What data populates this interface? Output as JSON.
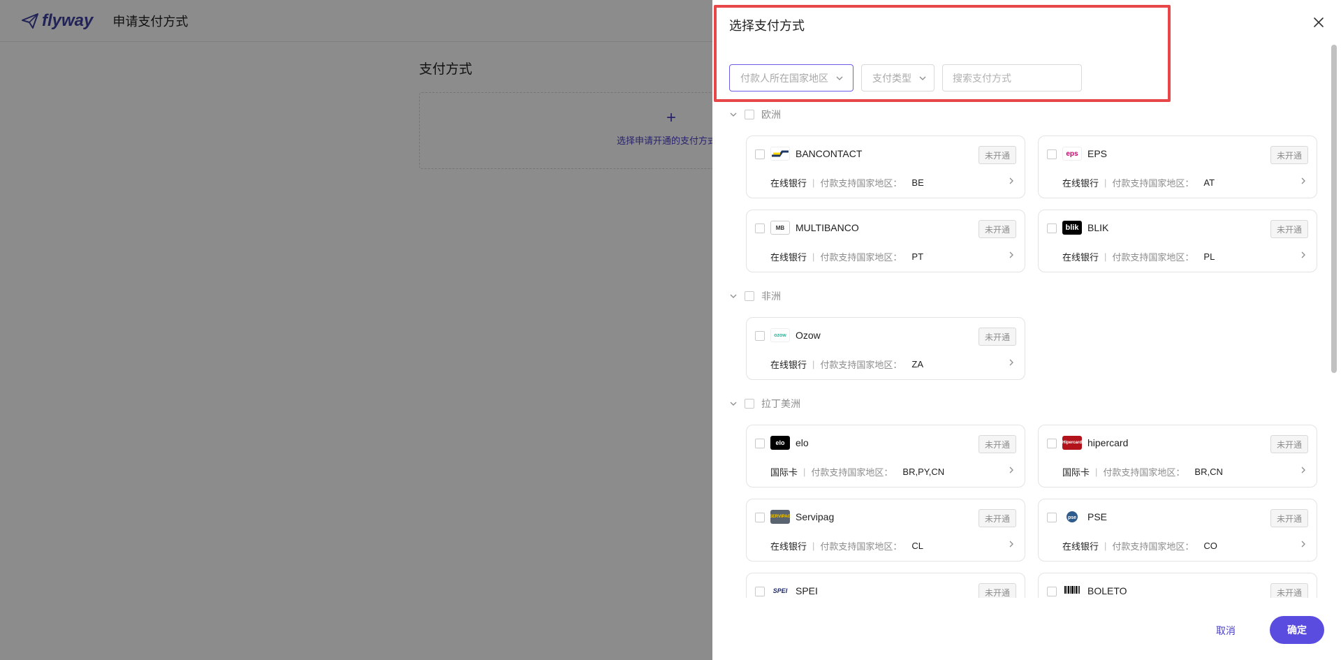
{
  "app": {
    "logo_text": "flyway",
    "page_title": "申请支付方式"
  },
  "background": {
    "section_title": "支付方式",
    "add_icon": "plus-icon",
    "add_text": "选择申请开通的支付方式"
  },
  "drawer": {
    "title": "选择支付方式",
    "close_icon": "close-icon",
    "highlight_color": "#e8474a",
    "filters": {
      "country_placeholder": "付款人所在国家地区",
      "type_placeholder": "支付类型",
      "search_placeholder": "搜索支付方式"
    },
    "regions": [
      {
        "name": "欧洲",
        "methods": [
          {
            "name": "BANCONTACT",
            "status": "未开通",
            "type": "在线银行",
            "label": "付款支持国家地区：",
            "codes": "BE",
            "logo": "bancontact-logo"
          },
          {
            "name": "EPS",
            "status": "未开通",
            "type": "在线银行",
            "label": "付款支持国家地区：",
            "codes": "AT",
            "logo": "eps-logo"
          },
          {
            "name": "MULTIBANCO",
            "status": "未开通",
            "type": "在线银行",
            "label": "付款支持国家地区：",
            "codes": "PT",
            "logo": "multibanco-logo"
          },
          {
            "name": "BLIK",
            "status": "未开通",
            "type": "在线银行",
            "label": "付款支持国家地区：",
            "codes": "PL",
            "logo": "blik-logo"
          }
        ]
      },
      {
        "name": "非洲",
        "methods": [
          {
            "name": "Ozow",
            "status": "未开通",
            "type": "在线银行",
            "label": "付款支持国家地区：",
            "codes": "ZA",
            "logo": "ozow-logo"
          }
        ]
      },
      {
        "name": "拉丁美洲",
        "methods": [
          {
            "name": "elo",
            "status": "未开通",
            "type": "国际卡",
            "label": "付款支持国家地区：",
            "codes": "BR,PY,CN",
            "logo": "elo-logo"
          },
          {
            "name": "hipercard",
            "status": "未开通",
            "type": "国际卡",
            "label": "付款支持国家地区：",
            "codes": "BR,CN",
            "logo": "hipercard-logo"
          },
          {
            "name": "Servipag",
            "status": "未开通",
            "type": "在线银行",
            "label": "付款支持国家地区：",
            "codes": "CL",
            "logo": "servipag-logo"
          },
          {
            "name": "PSE",
            "status": "未开通",
            "type": "在线银行",
            "label": "付款支持国家地区：",
            "codes": "CO",
            "logo": "pse-logo"
          },
          {
            "name": "SPEI",
            "status": "未开通",
            "type": "",
            "label": "",
            "codes": "",
            "logo": "spei-logo"
          },
          {
            "name": "BOLETO",
            "status": "未开通",
            "type": "",
            "label": "",
            "codes": "",
            "logo": "boleto-logo"
          }
        ]
      }
    ],
    "footer": {
      "cancel_label": "取消",
      "confirm_label": "确定"
    }
  },
  "colors": {
    "brand": "#5b4ce0",
    "brand_text": "#4a3fc7",
    "logo": "#3d3f9e"
  }
}
